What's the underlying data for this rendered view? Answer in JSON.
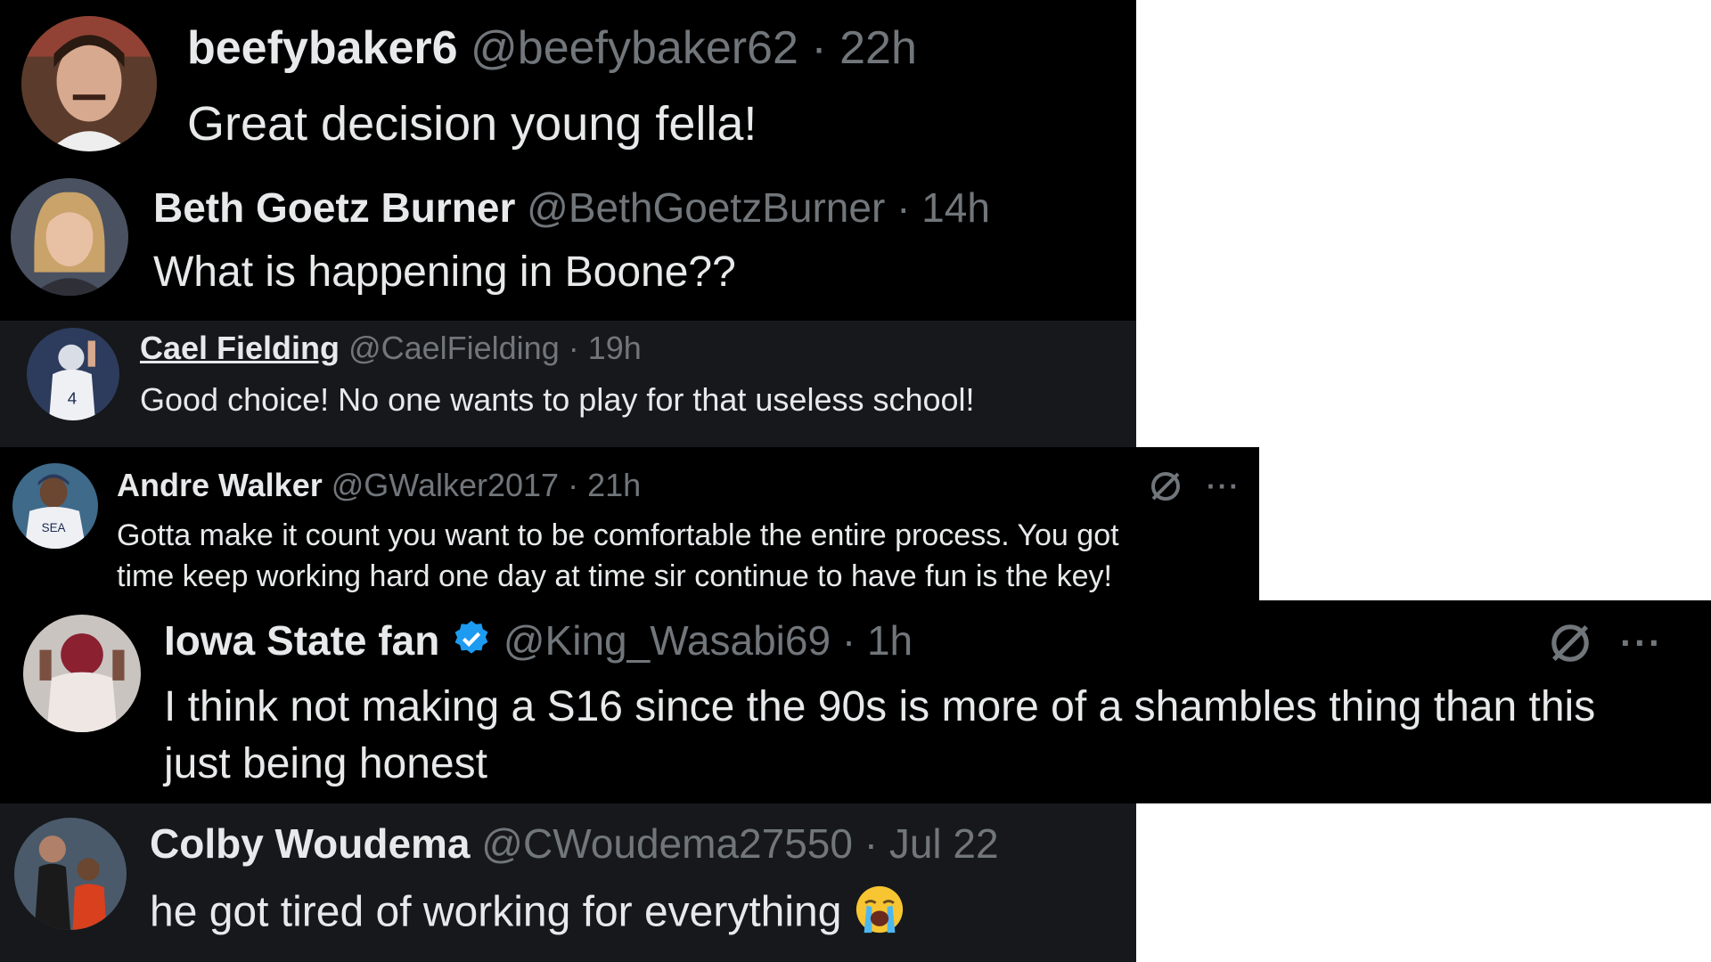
{
  "replies": [
    {
      "display_name": "beefybaker6",
      "handle": "@beefybaker62",
      "separator": "·",
      "time": "22h",
      "text": "Great decision young fella!"
    },
    {
      "display_name": "Beth Goetz Burner",
      "handle": "@BethGoetzBurner",
      "separator": "·",
      "time": "14h",
      "text": "What is happening in Boone??"
    },
    {
      "display_name": "Cael Fielding",
      "handle": "@CaelFielding",
      "separator": "·",
      "time": "19h",
      "text": "Good choice! No one wants to play for that useless school!"
    },
    {
      "display_name": "Andre Walker",
      "handle": "@GWalker2017",
      "separator": "·",
      "time": "21h",
      "text_lines": [
        "Gotta make it count you want to be comfortable the entire process. You got",
        "time keep working hard one day at time sir continue to have fun is the key!"
      ],
      "more": "···"
    },
    {
      "display_name": "Iowa State fan",
      "handle": "@King_Wasabi69",
      "separator": "·",
      "time": "1h",
      "verified": true,
      "text_lines": [
        "I think not making a S16 since the 90s is more of a shambles thing than this",
        "just being honest"
      ],
      "more": "···"
    },
    {
      "display_name": "Colby Woudema",
      "handle": "@CWoudema27550",
      "separator": "·",
      "time": "Jul 22",
      "text": "he got tired of working for everything",
      "emoji": "loudly-crying-face-emoji"
    }
  ],
  "colors": {
    "background_dark": "#000000",
    "background_dim": "#16181c",
    "name": "#e7e9ea",
    "secondary": "#71767b",
    "verified": "#1d9bf0",
    "page": "#ffffff"
  },
  "icons": [
    "grok-icon",
    "more-icon",
    "verified-badge-icon"
  ]
}
